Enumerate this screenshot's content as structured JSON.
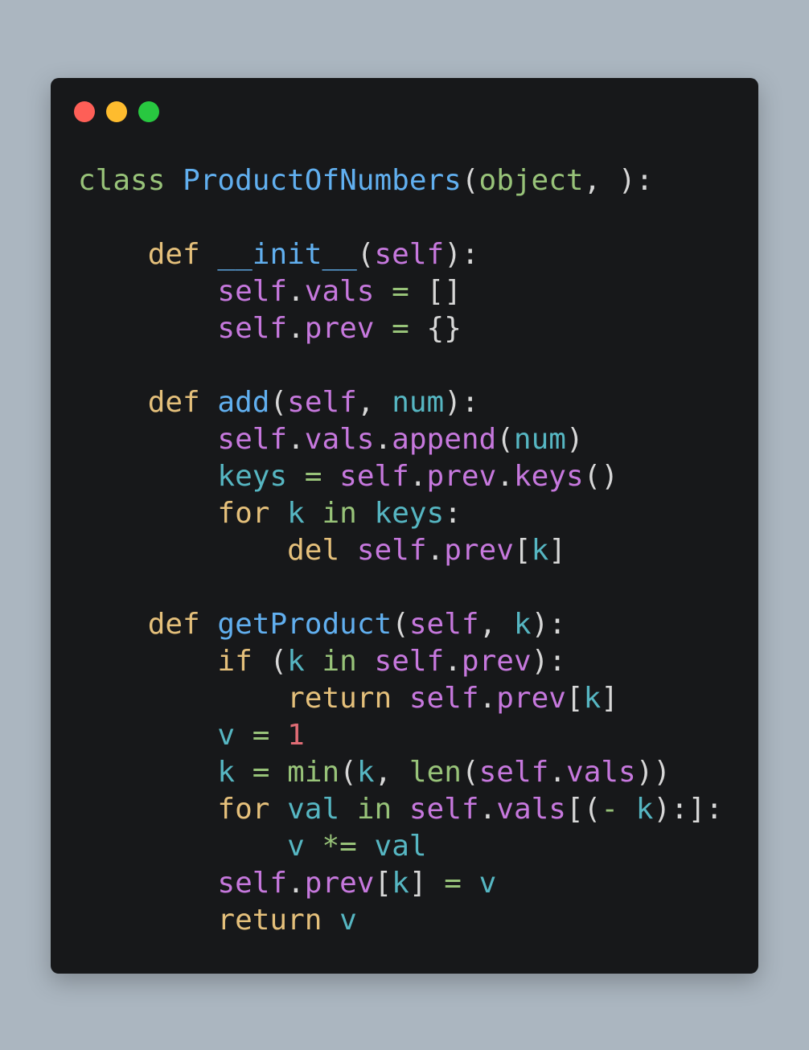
{
  "window": {
    "controls": [
      {
        "name": "close",
        "color": "#fe5f57"
      },
      {
        "name": "minimize",
        "color": "#febc2e"
      },
      {
        "name": "zoom",
        "color": "#28c840"
      }
    ]
  },
  "colors": {
    "kw": "#e5c07b",
    "fn": "#61afef",
    "self": "#c678dd",
    "var": "#56b6c2",
    "op": "#98c379",
    "punc": "#d7d7d7",
    "num": "#e06c75",
    "builtin": "#98c379"
  },
  "code_lines": [
    [
      {
        "t": "class",
        "c": "op"
      },
      {
        "t": " ",
        "c": "punc"
      },
      {
        "t": "ProductOfNumbers",
        "c": "fn"
      },
      {
        "t": "(",
        "c": "punc"
      },
      {
        "t": "object",
        "c": "builtin"
      },
      {
        "t": ", ):",
        "c": "punc"
      }
    ],
    [],
    [
      {
        "t": "    ",
        "c": "punc"
      },
      {
        "t": "def",
        "c": "kw"
      },
      {
        "t": " ",
        "c": "punc"
      },
      {
        "t": "__init__",
        "c": "fn"
      },
      {
        "t": "(",
        "c": "punc"
      },
      {
        "t": "self",
        "c": "self"
      },
      {
        "t": "):",
        "c": "punc"
      }
    ],
    [
      {
        "t": "        ",
        "c": "punc"
      },
      {
        "t": "self",
        "c": "self"
      },
      {
        "t": ".",
        "c": "punc"
      },
      {
        "t": "vals",
        "c": "self"
      },
      {
        "t": " ",
        "c": "punc"
      },
      {
        "t": "=",
        "c": "op"
      },
      {
        "t": " []",
        "c": "punc"
      }
    ],
    [
      {
        "t": "        ",
        "c": "punc"
      },
      {
        "t": "self",
        "c": "self"
      },
      {
        "t": ".",
        "c": "punc"
      },
      {
        "t": "prev",
        "c": "self"
      },
      {
        "t": " ",
        "c": "punc"
      },
      {
        "t": "=",
        "c": "op"
      },
      {
        "t": " {}",
        "c": "punc"
      }
    ],
    [],
    [
      {
        "t": "    ",
        "c": "punc"
      },
      {
        "t": "def",
        "c": "kw"
      },
      {
        "t": " ",
        "c": "punc"
      },
      {
        "t": "add",
        "c": "fn"
      },
      {
        "t": "(",
        "c": "punc"
      },
      {
        "t": "self",
        "c": "self"
      },
      {
        "t": ", ",
        "c": "punc"
      },
      {
        "t": "num",
        "c": "var"
      },
      {
        "t": "):",
        "c": "punc"
      }
    ],
    [
      {
        "t": "        ",
        "c": "punc"
      },
      {
        "t": "self",
        "c": "self"
      },
      {
        "t": ".",
        "c": "punc"
      },
      {
        "t": "vals",
        "c": "self"
      },
      {
        "t": ".",
        "c": "punc"
      },
      {
        "t": "append",
        "c": "self"
      },
      {
        "t": "(",
        "c": "punc"
      },
      {
        "t": "num",
        "c": "var"
      },
      {
        "t": ")",
        "c": "punc"
      }
    ],
    [
      {
        "t": "        ",
        "c": "punc"
      },
      {
        "t": "keys",
        "c": "var"
      },
      {
        "t": " ",
        "c": "punc"
      },
      {
        "t": "=",
        "c": "op"
      },
      {
        "t": " ",
        "c": "punc"
      },
      {
        "t": "self",
        "c": "self"
      },
      {
        "t": ".",
        "c": "punc"
      },
      {
        "t": "prev",
        "c": "self"
      },
      {
        "t": ".",
        "c": "punc"
      },
      {
        "t": "keys",
        "c": "self"
      },
      {
        "t": "()",
        "c": "punc"
      }
    ],
    [
      {
        "t": "        ",
        "c": "punc"
      },
      {
        "t": "for",
        "c": "kw"
      },
      {
        "t": " ",
        "c": "punc"
      },
      {
        "t": "k",
        "c": "var"
      },
      {
        "t": " ",
        "c": "punc"
      },
      {
        "t": "in",
        "c": "op"
      },
      {
        "t": " ",
        "c": "punc"
      },
      {
        "t": "keys",
        "c": "var"
      },
      {
        "t": ":",
        "c": "punc"
      }
    ],
    [
      {
        "t": "            ",
        "c": "punc"
      },
      {
        "t": "del",
        "c": "kw"
      },
      {
        "t": " ",
        "c": "punc"
      },
      {
        "t": "self",
        "c": "self"
      },
      {
        "t": ".",
        "c": "punc"
      },
      {
        "t": "prev",
        "c": "self"
      },
      {
        "t": "[",
        "c": "punc"
      },
      {
        "t": "k",
        "c": "var"
      },
      {
        "t": "]",
        "c": "punc"
      }
    ],
    [],
    [
      {
        "t": "    ",
        "c": "punc"
      },
      {
        "t": "def",
        "c": "kw"
      },
      {
        "t": " ",
        "c": "punc"
      },
      {
        "t": "getProduct",
        "c": "fn"
      },
      {
        "t": "(",
        "c": "punc"
      },
      {
        "t": "self",
        "c": "self"
      },
      {
        "t": ", ",
        "c": "punc"
      },
      {
        "t": "k",
        "c": "var"
      },
      {
        "t": "):",
        "c": "punc"
      }
    ],
    [
      {
        "t": "        ",
        "c": "punc"
      },
      {
        "t": "if",
        "c": "kw"
      },
      {
        "t": " (",
        "c": "punc"
      },
      {
        "t": "k",
        "c": "var"
      },
      {
        "t": " ",
        "c": "punc"
      },
      {
        "t": "in",
        "c": "op"
      },
      {
        "t": " ",
        "c": "punc"
      },
      {
        "t": "self",
        "c": "self"
      },
      {
        "t": ".",
        "c": "punc"
      },
      {
        "t": "prev",
        "c": "self"
      },
      {
        "t": "):",
        "c": "punc"
      }
    ],
    [
      {
        "t": "            ",
        "c": "punc"
      },
      {
        "t": "return",
        "c": "kw"
      },
      {
        "t": " ",
        "c": "punc"
      },
      {
        "t": "self",
        "c": "self"
      },
      {
        "t": ".",
        "c": "punc"
      },
      {
        "t": "prev",
        "c": "self"
      },
      {
        "t": "[",
        "c": "punc"
      },
      {
        "t": "k",
        "c": "var"
      },
      {
        "t": "]",
        "c": "punc"
      }
    ],
    [
      {
        "t": "        ",
        "c": "punc"
      },
      {
        "t": "v",
        "c": "var"
      },
      {
        "t": " ",
        "c": "punc"
      },
      {
        "t": "=",
        "c": "op"
      },
      {
        "t": " ",
        "c": "punc"
      },
      {
        "t": "1",
        "c": "num"
      }
    ],
    [
      {
        "t": "        ",
        "c": "punc"
      },
      {
        "t": "k",
        "c": "var"
      },
      {
        "t": " ",
        "c": "punc"
      },
      {
        "t": "=",
        "c": "op"
      },
      {
        "t": " ",
        "c": "punc"
      },
      {
        "t": "min",
        "c": "builtin"
      },
      {
        "t": "(",
        "c": "punc"
      },
      {
        "t": "k",
        "c": "var"
      },
      {
        "t": ", ",
        "c": "punc"
      },
      {
        "t": "len",
        "c": "builtin"
      },
      {
        "t": "(",
        "c": "punc"
      },
      {
        "t": "self",
        "c": "self"
      },
      {
        "t": ".",
        "c": "punc"
      },
      {
        "t": "vals",
        "c": "self"
      },
      {
        "t": "))",
        "c": "punc"
      }
    ],
    [
      {
        "t": "        ",
        "c": "punc"
      },
      {
        "t": "for",
        "c": "kw"
      },
      {
        "t": " ",
        "c": "punc"
      },
      {
        "t": "val",
        "c": "var"
      },
      {
        "t": " ",
        "c": "punc"
      },
      {
        "t": "in",
        "c": "op"
      },
      {
        "t": " ",
        "c": "punc"
      },
      {
        "t": "self",
        "c": "self"
      },
      {
        "t": ".",
        "c": "punc"
      },
      {
        "t": "vals",
        "c": "self"
      },
      {
        "t": "[(",
        "c": "punc"
      },
      {
        "t": "-",
        "c": "op"
      },
      {
        "t": " ",
        "c": "punc"
      },
      {
        "t": "k",
        "c": "var"
      },
      {
        "t": "):]:",
        "c": "punc"
      }
    ],
    [
      {
        "t": "            ",
        "c": "punc"
      },
      {
        "t": "v",
        "c": "var"
      },
      {
        "t": " ",
        "c": "punc"
      },
      {
        "t": "*=",
        "c": "op"
      },
      {
        "t": " ",
        "c": "punc"
      },
      {
        "t": "val",
        "c": "var"
      }
    ],
    [
      {
        "t": "        ",
        "c": "punc"
      },
      {
        "t": "self",
        "c": "self"
      },
      {
        "t": ".",
        "c": "punc"
      },
      {
        "t": "prev",
        "c": "self"
      },
      {
        "t": "[",
        "c": "punc"
      },
      {
        "t": "k",
        "c": "var"
      },
      {
        "t": "]",
        "c": "punc"
      },
      {
        "t": " ",
        "c": "punc"
      },
      {
        "t": "=",
        "c": "op"
      },
      {
        "t": " ",
        "c": "punc"
      },
      {
        "t": "v",
        "c": "var"
      }
    ],
    [
      {
        "t": "        ",
        "c": "punc"
      },
      {
        "t": "return",
        "c": "kw"
      },
      {
        "t": " ",
        "c": "punc"
      },
      {
        "t": "v",
        "c": "var"
      }
    ]
  ]
}
